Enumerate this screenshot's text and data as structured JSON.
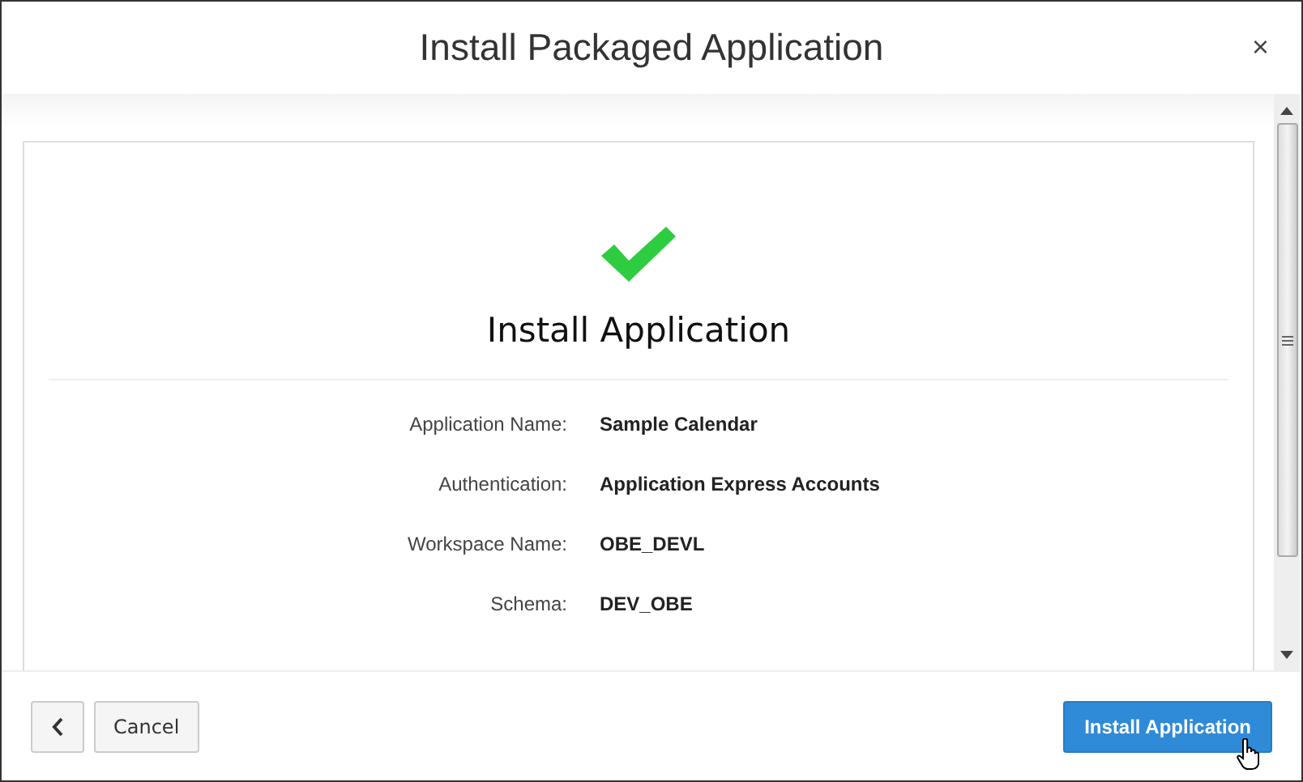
{
  "dialog": {
    "title": "Install Packaged Application",
    "close": "×"
  },
  "card": {
    "heading": "Install Application",
    "fields": [
      {
        "label": "Application Name:",
        "value": "Sample Calendar"
      },
      {
        "label": "Authentication:",
        "value": "Application Express Accounts"
      },
      {
        "label": "Workspace Name:",
        "value": "OBE_DEVL"
      },
      {
        "label": "Schema:",
        "value": "DEV_OBE"
      }
    ]
  },
  "footer": {
    "buttons": [
      {
        "kind": "back"
      },
      {
        "kind": "secondary",
        "label": "Cancel"
      },
      {
        "kind": "primary",
        "label": "Install Application"
      }
    ]
  }
}
